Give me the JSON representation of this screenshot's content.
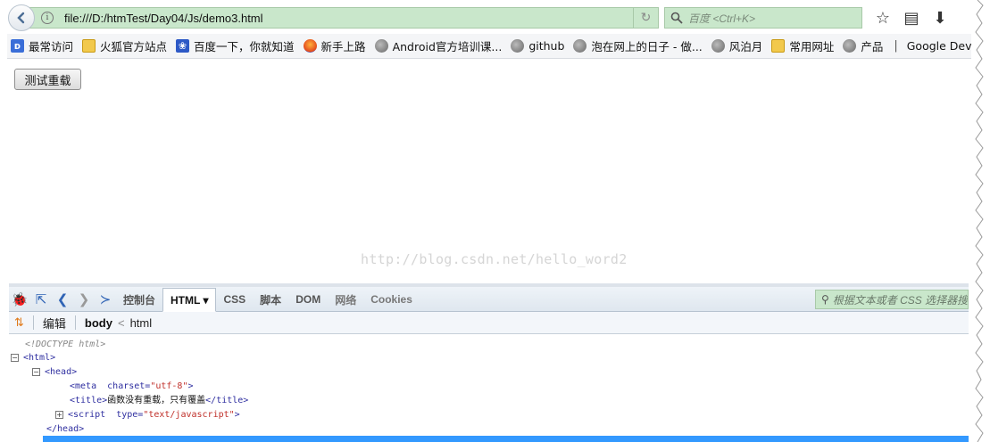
{
  "toolbar": {
    "url": "file:///D:/htmTest/Day04/Js/demo3.html",
    "search_placeholder": "百度 <Ctrl+K>"
  },
  "bookmarks": [
    {
      "label": "最常访问",
      "icon": "bookmark-blue-icon"
    },
    {
      "label": "火狐官方站点",
      "icon": "folder-icon"
    },
    {
      "label": "百度一下，你就知道",
      "icon": "baidu-paw-icon"
    },
    {
      "label": "新手上路",
      "icon": "firefox-icon"
    },
    {
      "label": "Android官方培训课...",
      "icon": "globe-icon"
    },
    {
      "label": "github",
      "icon": "globe-icon"
    },
    {
      "label": "泡在网上的日子 - 做...",
      "icon": "globe-icon"
    },
    {
      "label": "风泊月",
      "icon": "globe-icon"
    },
    {
      "label": "常用网址",
      "icon": "folder-icon"
    },
    {
      "label": "产品",
      "icon": "globe-icon"
    },
    {
      "label": "Google Dev...",
      "icon": ""
    }
  ],
  "bookmark_separator": "|",
  "page": {
    "button_label": "测试重载",
    "watermark": "http://blog.csdn.net/hello_word2"
  },
  "devtools": {
    "tabs": [
      "控制台",
      "HTML ▾",
      "CSS",
      "脚本",
      "DOM",
      "网络",
      "Cookies"
    ],
    "active_tab": "HTML",
    "search_placeholder": "根据文本或者 CSS 选择器搜索",
    "edit_label": "编辑",
    "crumb_body": "body",
    "crumb_sep": "<",
    "crumb_html": "html",
    "tree": {
      "doctype": "<!DOCTYPE html>",
      "html_open": "<html>",
      "head_open": "<head>",
      "meta_tag": "<meta",
      "meta_attr": "charset=",
      "meta_val": "\"utf-8\"",
      "meta_close": ">",
      "title_open": "<title>",
      "title_text": "函数没有重载，只有覆盖",
      "title_close": "</title>",
      "script_tag": "<script",
      "script_attr": "type=",
      "script_val": "\"text/javascript\"",
      "script_close": ">",
      "head_close": "</head>"
    }
  }
}
